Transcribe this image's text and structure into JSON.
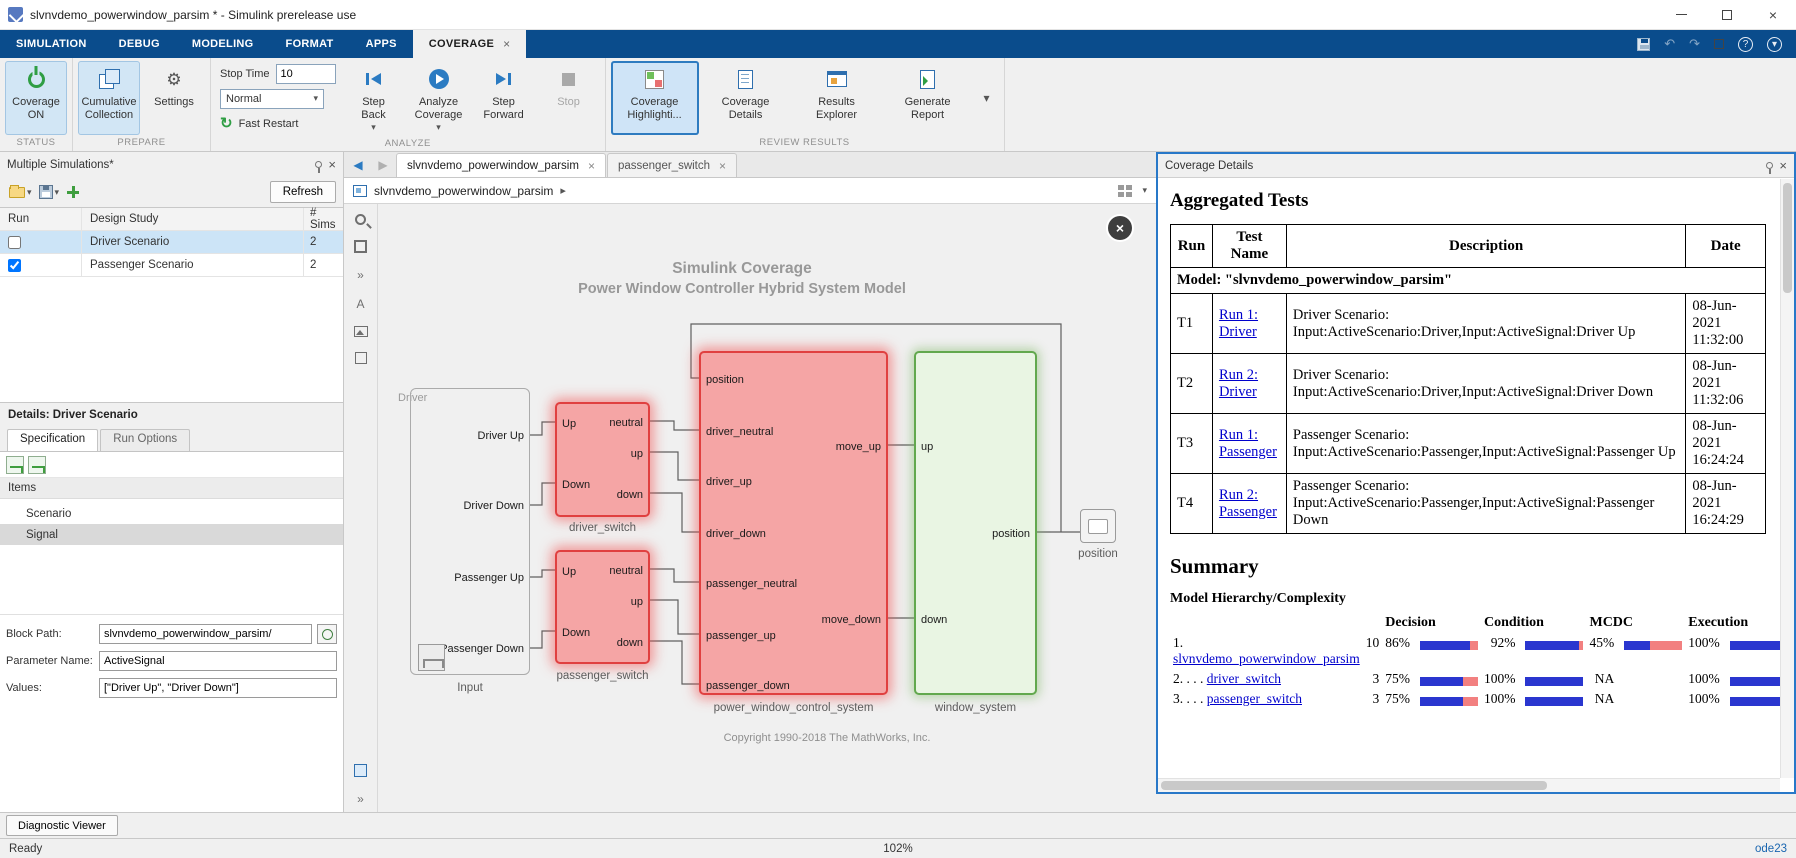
{
  "window": {
    "title": "slvnvdemo_powerwindow_parsim * - Simulink prerelease use"
  },
  "icons": {
    "gear": "⚙",
    "undo": "↶",
    "redo": "↷",
    "help": "?",
    "close": "×",
    "dropdown": "▾",
    "crumb_arrow": "▸",
    "chevrons": "»",
    "letter_a": "A",
    "restart": "↻",
    "back": "◀",
    "forward": "▶"
  },
  "ribbon": {
    "tabs": [
      "SIMULATION",
      "DEBUG",
      "MODELING",
      "FORMAT",
      "APPS",
      "COVERAGE"
    ],
    "sections": {
      "status": "STATUS",
      "prepare": "PREPARE",
      "analyze": "ANALYZE",
      "review": "REVIEW RESULTS"
    },
    "coverage_on": "Coverage\nON",
    "cumulative_collection": "Cumulative\nCollection",
    "settings": "Settings",
    "stop_time_label": "Stop Time",
    "stop_time_value": "10",
    "sim_mode": "Normal",
    "fast_restart": "Fast Restart",
    "step_back": "Step\nBack",
    "analyze_coverage": "Analyze\nCoverage",
    "step_forward": "Step\nForward",
    "stop": "Stop",
    "coverage_highlighting": "Coverage\nHighlighti...",
    "coverage_details": "Coverage\nDetails",
    "results_explorer": "Results\nExplorer",
    "generate_report": "Generate\nReport"
  },
  "left_panel": {
    "title": "Multiple Simulations*",
    "refresh": "Refresh",
    "table": {
      "headers": [
        "Run",
        "Design Study",
        "# Sims"
      ],
      "rows": [
        {
          "checked": false,
          "study": "Driver Scenario",
          "sims": "2"
        },
        {
          "checked": true,
          "study": "Passenger Scenario",
          "sims": "2"
        }
      ]
    },
    "details_title": "Details: Driver Scenario",
    "tabs": [
      "Specification",
      "Run Options"
    ],
    "items_header": "Items",
    "items": [
      "Scenario",
      "Signal"
    ],
    "fields": [
      {
        "label": "Block Path:",
        "value": "slvnvdemo_powerwindow_parsim/"
      },
      {
        "label": "Parameter Name:",
        "value": "ActiveSignal"
      },
      {
        "label": "Values:",
        "value": "[\"Driver Up\", \"Driver Down\"]"
      }
    ],
    "diagnostic_viewer": "Diagnostic Viewer"
  },
  "editor": {
    "doc_tabs": [
      "slvnvdemo_powerwindow_parsim",
      "passenger_switch"
    ],
    "breadcrumb": "slvnvdemo_powerwindow_parsim",
    "diagram": {
      "title1": "Simulink Coverage",
      "title2": "Power Window Controller Hybrid System Model",
      "area_label": "Driver",
      "input_block": {
        "caption": "Input",
        "ports": [
          "Driver Up",
          "Driver Down",
          "Passenger Up",
          "Passenger Down"
        ]
      },
      "switch_ports": {
        "inputs": [
          "Up",
          "Down"
        ],
        "outputs": [
          "neutral",
          "up",
          "down"
        ]
      },
      "driver_switch_caption": "driver_switch",
      "passenger_switch_caption": "passenger_switch",
      "control": {
        "caption": "power_window_control_system",
        "in": [
          "position",
          "driver_neutral",
          "driver_up",
          "driver_down",
          "passenger_neutral",
          "passenger_up",
          "passenger_down"
        ],
        "out": [
          "move_up",
          "move_down"
        ]
      },
      "window_system": {
        "caption": "window_system",
        "in": [
          "up",
          "down"
        ],
        "out": [
          "position"
        ]
      },
      "position_caption": "position",
      "copyright": "Copyright 1990-2018 The MathWorks, Inc."
    }
  },
  "coverage_panel": {
    "title": "Coverage Details",
    "aggregated": {
      "heading": "Aggregated Tests",
      "headers": [
        "Run",
        "Test Name",
        "Description",
        "Date"
      ],
      "model_row": "Model: \"slvnvdemo_powerwindow_parsim\"",
      "rows": [
        {
          "run": "T1",
          "test": "Run 1: Driver",
          "desc": "Driver Scenario: Input:ActiveScenario:Driver,Input:ActiveSignal:Driver Up",
          "date": "08-Jun-2021 11:32:00"
        },
        {
          "run": "T2",
          "test": "Run 2: Driver",
          "desc": "Driver Scenario: Input:ActiveScenario:Driver,Input:ActiveSignal:Driver Down",
          "date": "08-Jun-2021 11:32:06"
        },
        {
          "run": "T3",
          "test": "Run 1: Passenger",
          "desc": "Passenger Scenario: Input:ActiveScenario:Passenger,Input:ActiveSignal:Passenger Up",
          "date": "08-Jun-2021 16:24:24"
        },
        {
          "run": "T4",
          "test": "Run 2: Passenger",
          "desc": "Passenger Scenario: Input:ActiveScenario:Passenger,Input:ActiveSignal:Passenger Down",
          "date": "08-Jun-2021 16:24:29"
        }
      ]
    },
    "summary": {
      "heading": "Summary",
      "subheading": "Model Hierarchy/Complexity",
      "metric_headers": [
        "Decision",
        "Condition",
        "MCDC",
        "Execution"
      ],
      "rows": [
        {
          "index": "1.",
          "name": "slvnvdemo_powerwindow_parsim",
          "complexity": "10",
          "decision": "86%",
          "condition": "92%",
          "mcdc": "45%",
          "execution": "100%"
        },
        {
          "index": "2. . . .",
          "name": "driver_switch",
          "complexity": "3",
          "decision": "75%",
          "condition": "100%",
          "mcdc": "NA",
          "execution": "100%"
        },
        {
          "index": "3. . . .",
          "name": "passenger_switch",
          "complexity": "3",
          "decision": "75%",
          "condition": "100%",
          "mcdc": "NA",
          "execution": "100%"
        }
      ]
    }
  },
  "statusbar": {
    "ready": "Ready",
    "zoom": "102%",
    "solver": "ode23"
  }
}
